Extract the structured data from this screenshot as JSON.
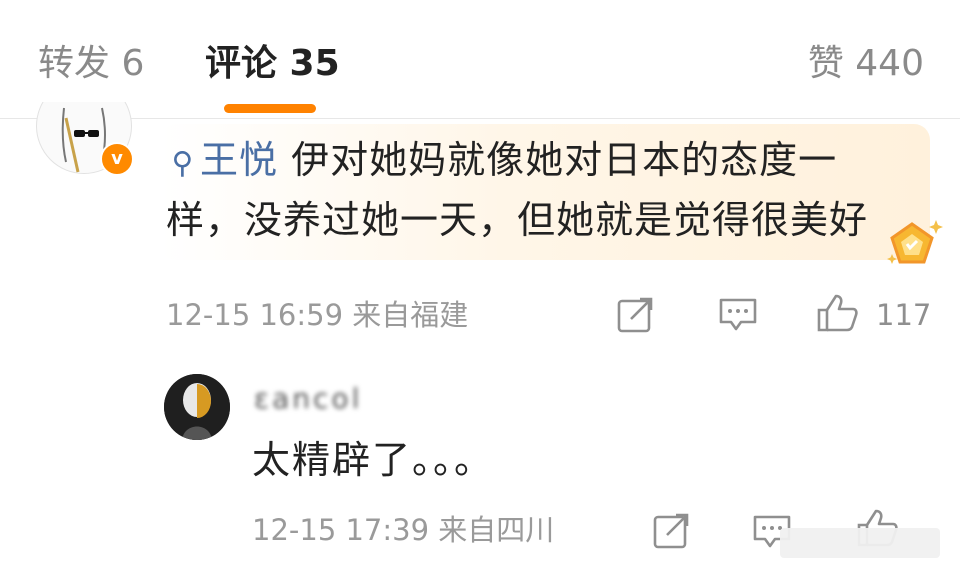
{
  "tabs": [
    {
      "label": "转发 6",
      "active": false
    },
    {
      "label": "评论 35",
      "active": true
    },
    {
      "label": "赞 440",
      "active": false
    }
  ],
  "accent_color": "#ff8200",
  "comments": [
    {
      "mention_icon": "search-icon",
      "mention": "王悦",
      "text": "伊对她妈就像她对日本的态度一样，没养过她一天，但她就是觉得很美好",
      "time": "12-15 16:59",
      "location": "来自福建",
      "like_count": "117",
      "badge": "v",
      "icons": [
        "repost-icon",
        "comment-icon",
        "like-icon"
      ]
    },
    {
      "username": "ɛancol",
      "text": "太精辟了。。。",
      "time": "12-15 17:39",
      "location": "来自四川",
      "icons": [
        "repost-icon",
        "comment-icon",
        "like-icon"
      ]
    }
  ]
}
